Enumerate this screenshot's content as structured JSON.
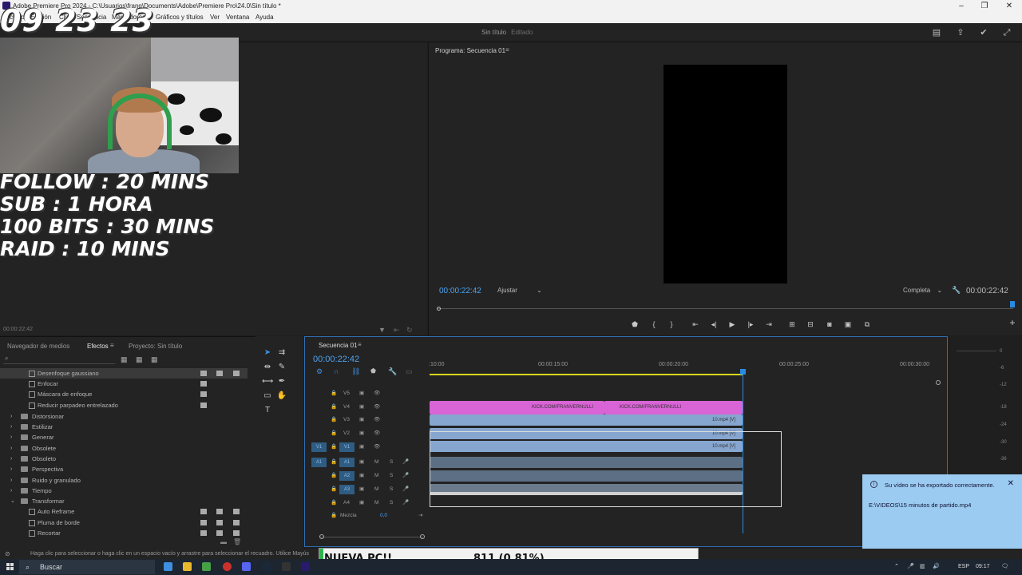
{
  "window": {
    "title": "Adobe Premiere Pro 2024 - C:\\Usuarios\\frang\\Documents\\Adobe\\Premiere Pro\\24.0\\Sin título *"
  },
  "menu": [
    "Archivo",
    "Edición",
    "Clip",
    "Secuencia",
    "Marcadores",
    "Gráficos y títulos",
    "Ver",
    "Ventana",
    "Ayuda"
  ],
  "header": {
    "doc_title": "Sin título",
    "doc_state": "Editado"
  },
  "overlay": {
    "clock": "09 23 23",
    "goals": [
      "FOLLOW : 20 MINS",
      "SUB : 1 HORA",
      "100 BITS : 30 MINS",
      "RAID : 10 MINS"
    ]
  },
  "source_panel": {
    "timecode": "00:00:22:42"
  },
  "program": {
    "title": "Programa: Secuencia 01",
    "timecode_left": "00:00:22:42",
    "fit": "Ajustar",
    "resolution": "Completa",
    "timecode_right": "00:00:22:42"
  },
  "effects_panel": {
    "tabs": [
      "Navegador de medios",
      "Efectos",
      "Proyecto: Sin título"
    ],
    "rows": [
      {
        "label": "Desenfoque gaussiano",
        "type": "item",
        "selected": true
      },
      {
        "label": "Enfocar",
        "type": "item"
      },
      {
        "label": "Máscara de enfoque",
        "type": "item"
      },
      {
        "label": "Reducir parpadeo entrelazado",
        "type": "item"
      },
      {
        "label": "Distorsionar",
        "type": "folder"
      },
      {
        "label": "Estilizar",
        "type": "folder"
      },
      {
        "label": "Generar",
        "type": "folder"
      },
      {
        "label": "Obsolete",
        "type": "folder"
      },
      {
        "label": "Obsoleto",
        "type": "folder"
      },
      {
        "label": "Perspectiva",
        "type": "folder"
      },
      {
        "label": "Ruido y granulado",
        "type": "folder"
      },
      {
        "label": "Tiempo",
        "type": "folder"
      },
      {
        "label": "Transformar",
        "type": "folder-open"
      },
      {
        "label": "Auto Reframe",
        "type": "item"
      },
      {
        "label": "Pluma de borde",
        "type": "item"
      },
      {
        "label": "Recortar",
        "type": "item"
      }
    ]
  },
  "timeline": {
    "sequence": "Secuencia 01",
    "timecode": "00:00:22:42",
    "ruler": [
      ":10:00",
      "00:00:15:00",
      "00:00:20:00",
      "00:00:25:00",
      "00:00:30:00"
    ],
    "tracks": [
      "V5",
      "V4",
      "V3",
      "V2",
      "V1",
      "A1",
      "A2",
      "A3",
      "A4"
    ],
    "v1_src": "V1",
    "a1_src": "A1",
    "mix_label": "Mezcla",
    "mix_value": "0,0",
    "clips": {
      "v4a": "KICK.COM/FRANVERNULLI",
      "v4b": "KICK.COM/FRANVERNULLI",
      "v3": "10.mp4 [V]",
      "v2": "10.mp4 [V]",
      "v1": "10.mp4 [V]"
    }
  },
  "meters": [
    "0",
    "-6",
    "-12",
    "-18",
    "-24",
    "-30",
    "-36"
  ],
  "notification": {
    "title": "Su vídeo se ha exportado correctamente.",
    "path": "E:\\VIDEOS\\15 minutos de partido.mp4"
  },
  "status_bar": "Haga clic para seleccionar o haga clic en un espacio vacío y arrastre para seleccionar el recuadro. Utilice Mayús",
  "goal_overlay": {
    "label": "NUEVA PC!!",
    "value": "811 (0.81%)",
    "progress": 0.0081
  },
  "taskbar": {
    "search": "Buscar",
    "lang": "ESP",
    "time": "09:17"
  }
}
